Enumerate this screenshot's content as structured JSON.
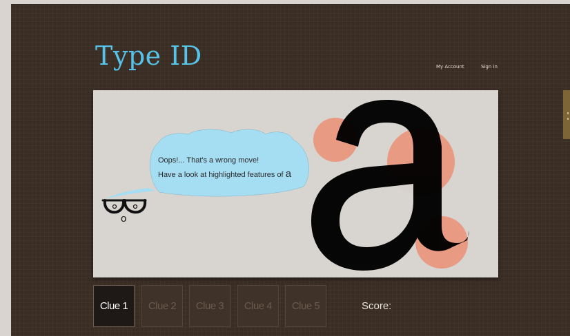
{
  "header": {
    "logo_text": "Type ",
    "logo_id": "ID",
    "nav": {
      "my_account": "My Account",
      "sign_in": "Sign in"
    }
  },
  "panel": {
    "message_line1": "Oops!... That's a wrong move!",
    "message_line2": "Have a look at highlighted features of ",
    "featured_letter": "a",
    "mascot_nose": "o"
  },
  "clues": [
    {
      "label": "Clue 1",
      "active": true
    },
    {
      "label": "Clue 2",
      "active": false
    },
    {
      "label": "Clue 3",
      "active": false
    },
    {
      "label": "Clue 4",
      "active": false
    },
    {
      "label": "Clue 5",
      "active": false
    }
  ],
  "score": {
    "label": "Score:"
  },
  "colors": {
    "brand_blue": "#56c4ea",
    "highlight_salmon": "#e89a83",
    "background_brown": "#3a2d24",
    "bubble_blue": "#a5ddf2"
  }
}
